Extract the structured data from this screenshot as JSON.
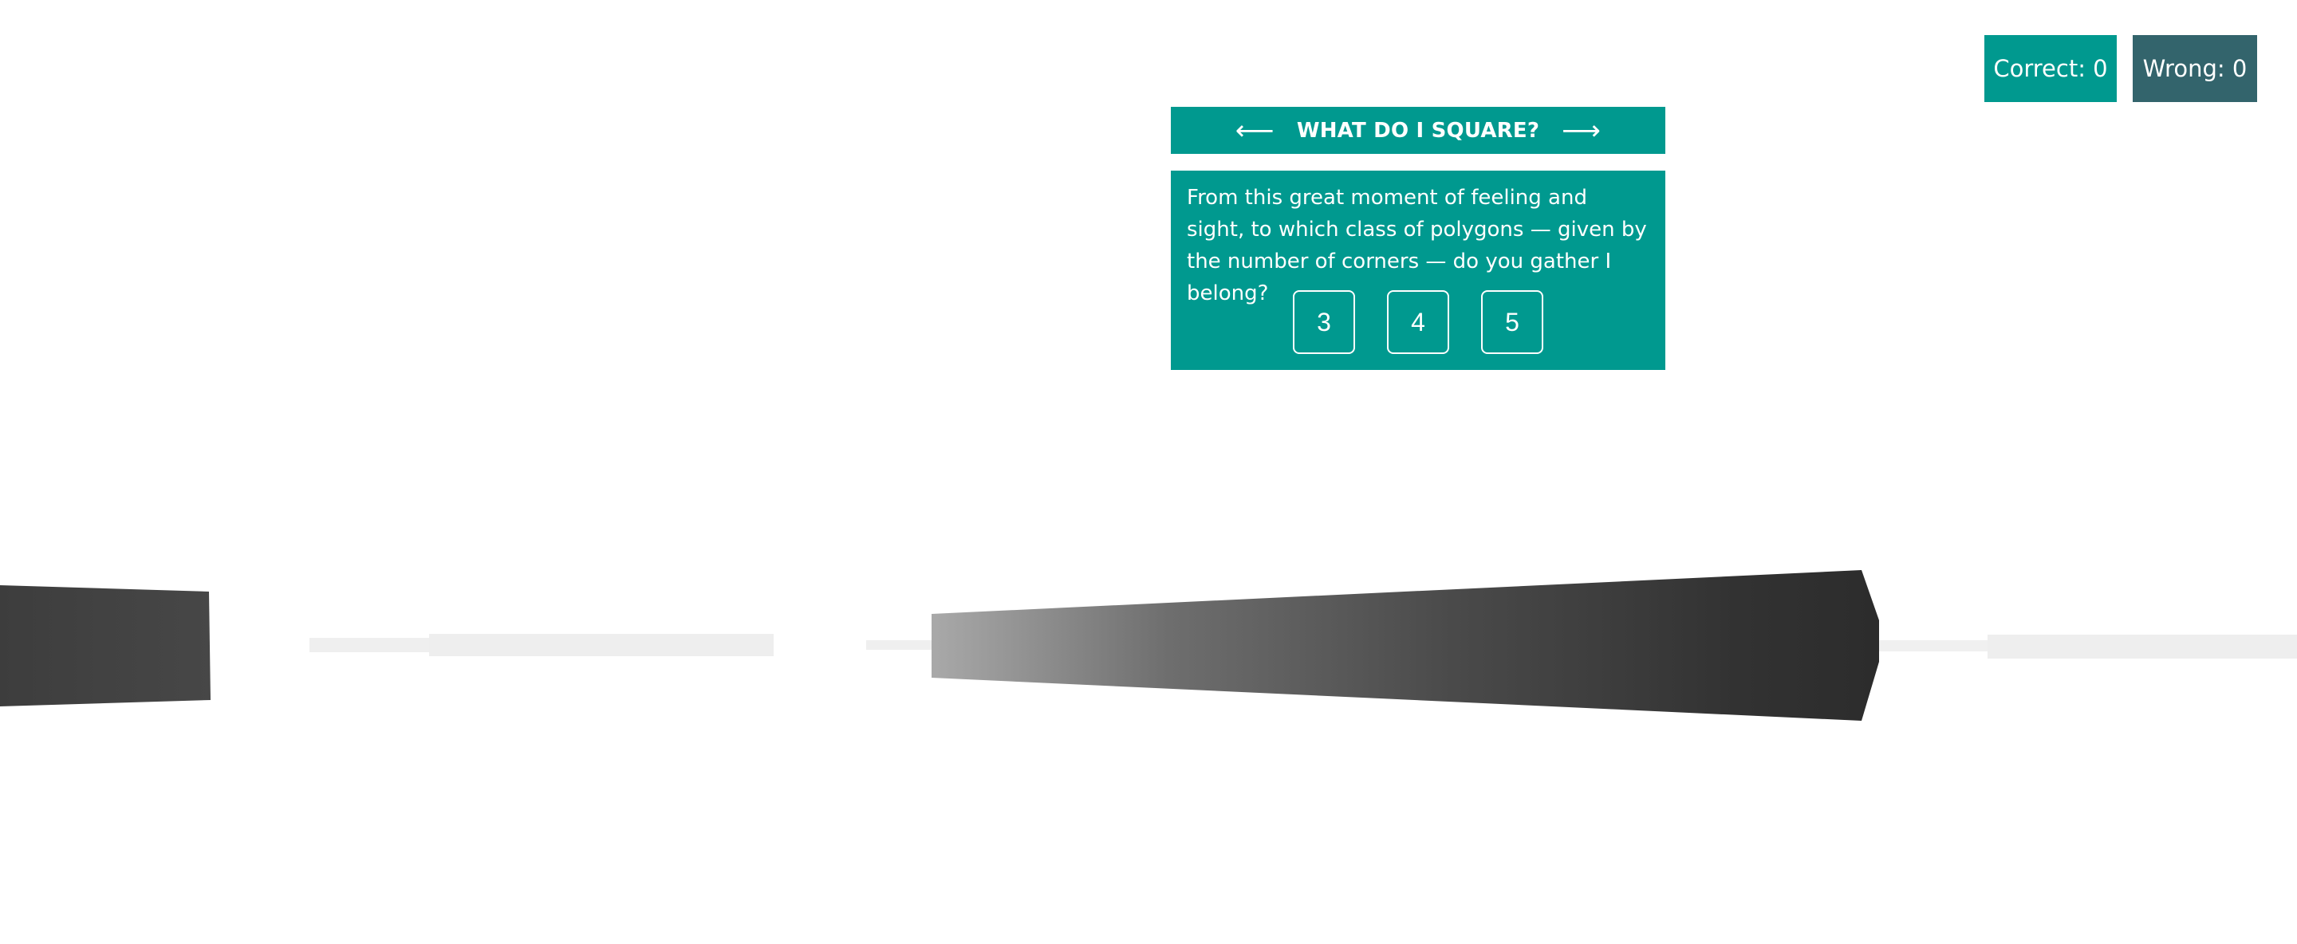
{
  "scoreboard": {
    "correct_label": "Correct: 0",
    "wrong_label": "Wrong: 0"
  },
  "panel": {
    "title": "WHAT DO I SQUARE?",
    "prev_arrow": "⟵",
    "next_arrow": "⟶",
    "question": "From this great moment of feeling and sight, to which class of polygons — given by the number of corners — do you gather I belong?",
    "answers": [
      "3",
      "4",
      "5"
    ]
  },
  "colors": {
    "teal": "#00998f",
    "slate": "#33646c",
    "dark_shape": "#2f2f2f",
    "light_shape": "#eeeeee"
  }
}
